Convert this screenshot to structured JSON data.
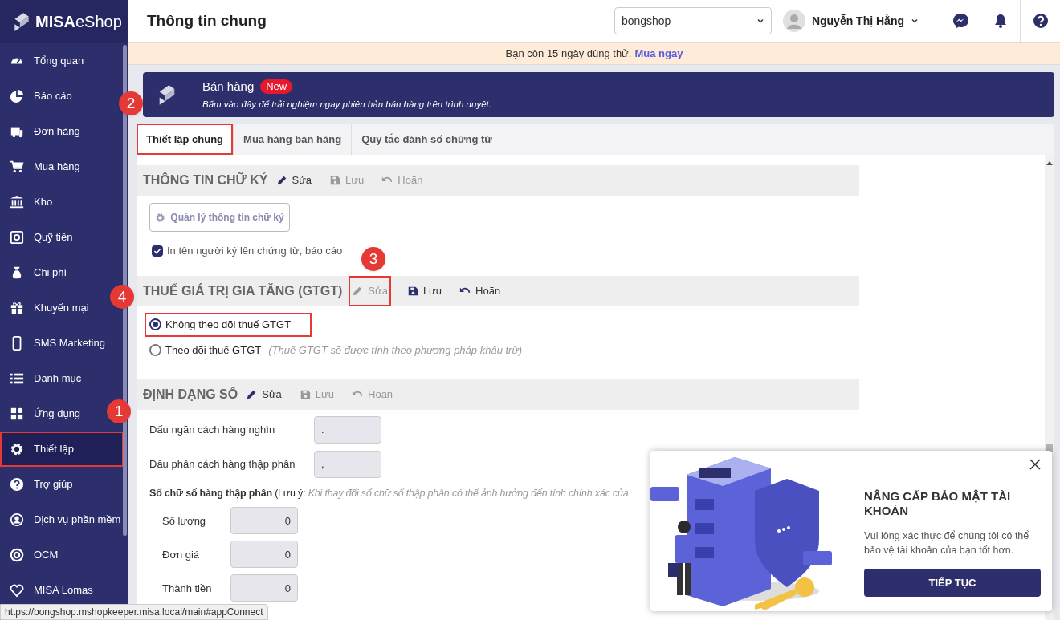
{
  "logo": {
    "brand": "MISA",
    "product": "eShop"
  },
  "sidebar": {
    "items": [
      {
        "label": "Tổng quan",
        "selected": false,
        "highlighted": false
      },
      {
        "label": "Báo cáo",
        "selected": false,
        "highlighted": false
      },
      {
        "label": "Đơn hàng",
        "selected": false,
        "highlighted": false
      },
      {
        "label": "Mua hàng",
        "selected": false,
        "highlighted": false
      },
      {
        "label": "Kho",
        "selected": false,
        "highlighted": false
      },
      {
        "label": "Quỹ tiền",
        "selected": false,
        "highlighted": false
      },
      {
        "label": "Chi phí",
        "selected": false,
        "highlighted": false
      },
      {
        "label": "Khuyến mại",
        "selected": false,
        "highlighted": false
      },
      {
        "label": "SMS Marketing",
        "selected": false,
        "highlighted": false
      },
      {
        "label": "Danh mục",
        "selected": false,
        "highlighted": false
      },
      {
        "label": "Ứng dụng",
        "selected": false,
        "highlighted": false
      },
      {
        "label": "Thiết lập",
        "selected": true,
        "highlighted": true
      },
      {
        "label": "Trợ giúp",
        "selected": false,
        "highlighted": false
      },
      {
        "label": "Dịch vụ phần mềm",
        "selected": false,
        "highlighted": false
      },
      {
        "label": "OCM",
        "selected": false,
        "highlighted": false
      },
      {
        "label": "MISA Lomas",
        "selected": false,
        "highlighted": false
      }
    ]
  },
  "header": {
    "title": "Thông tin chung",
    "shop_select": "bongshop",
    "user_name": "Nguyễn Thị Hằng"
  },
  "trial": {
    "text": "Bạn còn 15 ngày dùng thử.",
    "link": "Mua ngay"
  },
  "promo": {
    "title": "Bán hàng",
    "badge": "New",
    "subtitle": "Bấm vào đây để trải nghiệm ngay phiên bản bán hàng trên trình duyệt."
  },
  "tabs": [
    {
      "label": "Thiết lập chung",
      "selected": true,
      "highlighted": true
    },
    {
      "label": "Mua hàng bán hàng",
      "selected": false,
      "highlighted": false
    },
    {
      "label": "Quy tắc đánh số chứng từ",
      "selected": false,
      "highlighted": false
    }
  ],
  "sections": [
    {
      "kind": "signature",
      "title": "THÔNG TIN CHỮ KÝ",
      "actions": [
        {
          "label": "Sửa",
          "disabled": false,
          "highlighted": false
        },
        {
          "label": "Lưu",
          "disabled": true,
          "highlighted": false
        },
        {
          "label": "Hoãn",
          "disabled": true,
          "highlighted": false
        }
      ],
      "button": "Quản lý thông tin chữ ký",
      "checkbox": {
        "label": "In tên người ký lên chứng từ, báo cáo",
        "checked": true
      }
    },
    {
      "kind": "radios",
      "title": "THUẾ GIÁ TRỊ GIA TĂNG (GTGT)",
      "actions": [
        {
          "label": "Sửa",
          "disabled": true,
          "highlighted": true
        },
        {
          "label": "Lưu",
          "disabled": false,
          "highlighted": false
        },
        {
          "label": "Hoãn",
          "disabled": false,
          "highlighted": false
        }
      ],
      "options": [
        {
          "label": "Không theo dõi thuế GTGT",
          "selected": true,
          "highlighted": true
        },
        {
          "label": "Theo dõi thuế GTGT",
          "note": "(Thuế GTGT sẽ được tính theo phương pháp khấu trừ)",
          "selected": false,
          "highlighted": false
        }
      ]
    },
    {
      "kind": "number_format",
      "title": "ĐỊNH DẠNG SỐ",
      "actions": [
        {
          "label": "Sửa",
          "disabled": false,
          "highlighted": false
        },
        {
          "label": "Lưu",
          "disabled": true,
          "highlighted": false
        },
        {
          "label": "Hoãn",
          "disabled": true,
          "highlighted": false
        }
      ],
      "fields": [
        {
          "label": "Dấu ngăn cách hàng nghìn",
          "value": "."
        },
        {
          "label": "Dấu phân cách hàng thập phân",
          "value": ","
        }
      ],
      "note": "**Số chữ số hàng thập phân** (Lưu ý: *Khi thay đổi số chữ số thập phân có thể ảnh hưởng đến tính chính xác của*",
      "decimal_fields": [
        {
          "label": "Số lượng",
          "value": "0"
        },
        {
          "label": "Đơn giá",
          "value": "0"
        },
        {
          "label": "Thành tiền",
          "value": "0"
        }
      ]
    }
  ],
  "popup": {
    "title": "NÂNG CẤP BẢO MẬT TÀI KHOẢN",
    "text": "Vui lòng xác thực để chúng tôi có thể bảo vệ tài khoản của bạn tốt hơn.",
    "button": "TIẾP TỤC"
  },
  "annotations": [
    "1",
    "2",
    "3",
    "4"
  ],
  "status_url": "https://bongshop.mshopkeeper.misa.local/main#appConnect"
}
